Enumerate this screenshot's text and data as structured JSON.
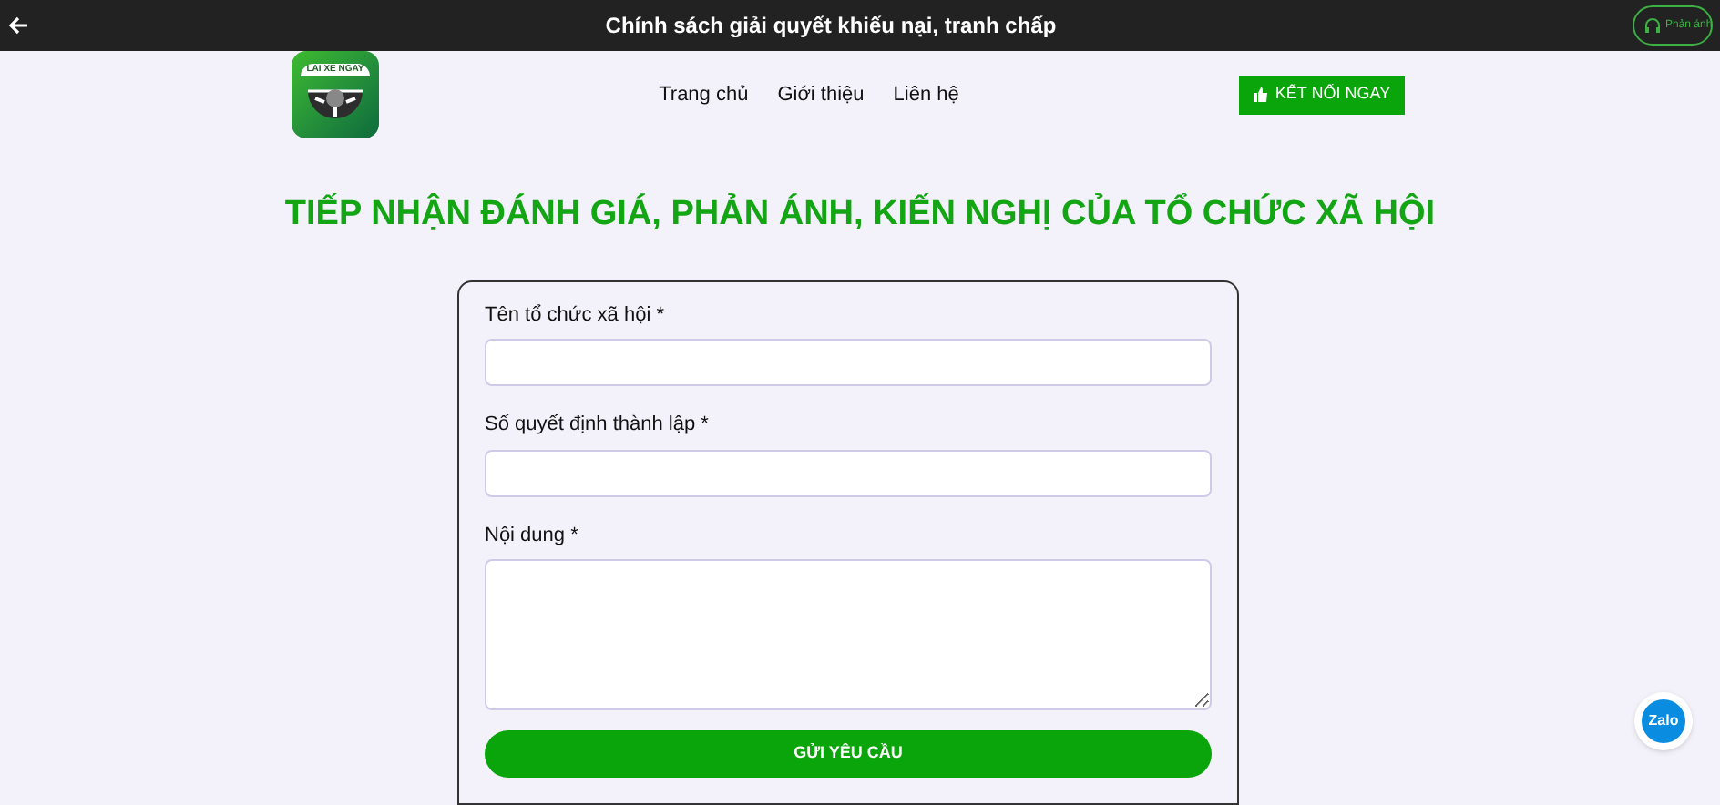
{
  "top_bar": {
    "title": "Chính sách giải quyết khiếu nại, tranh chấp",
    "feedback_button": "Phản ánh"
  },
  "header": {
    "logo_text": "LAI XE NGAY",
    "nav": [
      {
        "label": "Trang chủ"
      },
      {
        "label": "Giới thiệu"
      },
      {
        "label": "Liên hệ"
      }
    ],
    "cta": "KẾT NỐI NGAY"
  },
  "heading": "TIẾP NHẬN ĐÁNH GIÁ, PHẢN ÁNH, KIẾN NGHỊ CỦA TỔ CHỨC XÃ HỘI",
  "form": {
    "fields": [
      {
        "label": "Tên tổ chức xã hội *",
        "kind": "input"
      },
      {
        "label": "Số quyết định thành lập *",
        "kind": "input"
      },
      {
        "label": "Nội dung *",
        "kind": "textarea"
      }
    ],
    "submit": "GỬI YÊU CẦU"
  },
  "chat_button": {
    "label": "Zalo"
  }
}
